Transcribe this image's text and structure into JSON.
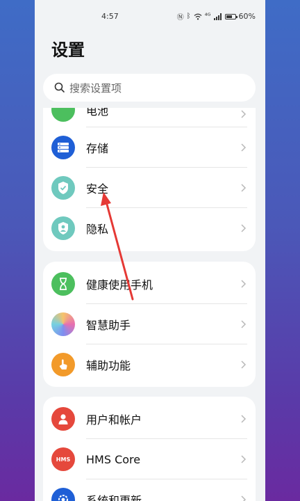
{
  "status_bar": {
    "time": "4:57",
    "battery": "60%",
    "network": "⁴ᴳ"
  },
  "page": {
    "title": "设置"
  },
  "search": {
    "placeholder": "搜索设置项"
  },
  "groups": [
    {
      "items": [
        {
          "label": "电池",
          "icon": "battery-icon",
          "color": "#4cbf5e"
        },
        {
          "label": "存储",
          "icon": "storage-icon",
          "color": "#1f5fd6"
        },
        {
          "label": "安全",
          "icon": "shield-icon",
          "color": "#6fc9be"
        },
        {
          "label": "隐私",
          "icon": "privacy-icon",
          "color": "#6fc9be"
        }
      ]
    },
    {
      "items": [
        {
          "label": "健康使用手机",
          "icon": "hourglass-icon",
          "color": "#4cbf5e"
        },
        {
          "label": "智慧助手",
          "icon": "assistant-icon",
          "color": "#e79ac4"
        },
        {
          "label": "辅助功能",
          "icon": "hand-icon",
          "color": "#f29a2a"
        }
      ]
    },
    {
      "items": [
        {
          "label": "用户和帐户",
          "icon": "user-icon",
          "color": "#e5483c"
        },
        {
          "label": "HMS Core",
          "icon": "hms-icon",
          "color": "#e5483c",
          "icon_text": "HMS"
        },
        {
          "label": "系统和更新",
          "icon": "system-icon",
          "color": "#1f5fd6"
        }
      ]
    }
  ],
  "colors": {
    "annotation_arrow": "#e53935",
    "background_top": "#3f6cc6",
    "background_bottom": "#6a2aa0"
  }
}
